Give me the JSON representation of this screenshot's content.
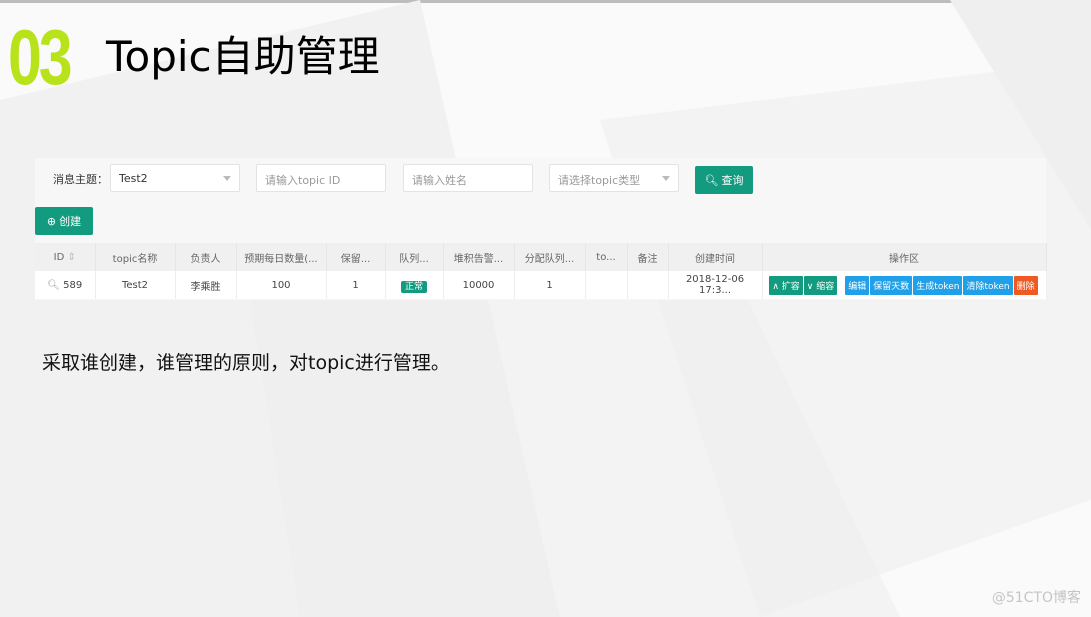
{
  "slide": {
    "number": "03",
    "title": "Topic自助管理",
    "body": "采取谁创建，谁管理的原则，对topic进行管理。",
    "watermark": "@51CTO博客"
  },
  "colors": {
    "accent": "#139b80",
    "blue": "#1fa0e8",
    "danger": "#f05a22",
    "number": "#b8e21a"
  },
  "filters": {
    "label": "消息主题：",
    "topic_value": "Test2",
    "topic_id_placeholder": "请输入topic ID",
    "name_placeholder": "请输入姓名",
    "type_placeholder": "请选择topic类型",
    "search_label": "查询",
    "create_label": "创建"
  },
  "table": {
    "headers": [
      "ID",
      "topic名称",
      "负责人",
      "预期每日数量(...",
      "保留...",
      "队列...",
      "堆积告警...",
      "分配队列...",
      "to...",
      "备注",
      "创建时间",
      "操作区"
    ],
    "rows": [
      {
        "id": "589",
        "name": "Test2",
        "owner": "李乘胜",
        "daily": "100",
        "retain": "1",
        "status": "正常",
        "backlog": "10000",
        "queues": "1",
        "to": "",
        "note": "",
        "created": "2018-12-06 17:3..."
      }
    ],
    "actions": {
      "expand": "扩容",
      "shrink": "缩容",
      "edit": "编辑",
      "retain_days": "保留天数",
      "gen_token": "生成token",
      "clear_token": "清除token",
      "delete": "删除"
    }
  }
}
